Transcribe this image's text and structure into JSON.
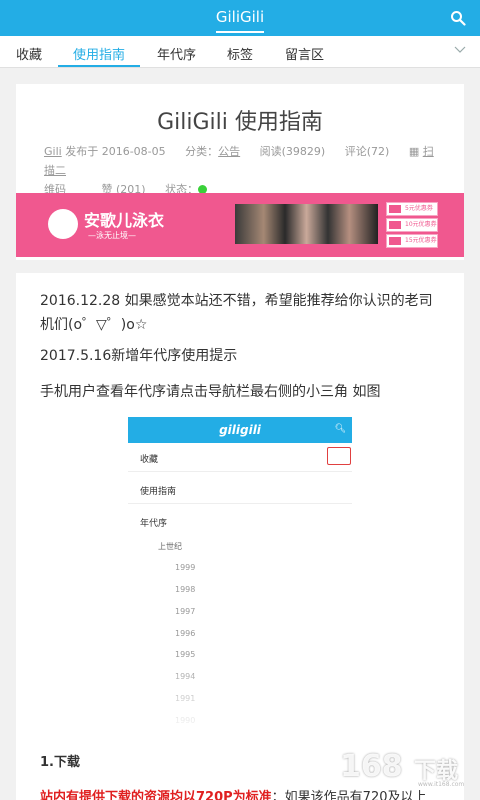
{
  "header": {
    "title": "GiliGili"
  },
  "nav": {
    "tabs": [
      {
        "label": "收藏"
      },
      {
        "label": "使用指南",
        "active": true
      },
      {
        "label": "年代序"
      },
      {
        "label": "标签"
      },
      {
        "label": "留言区"
      }
    ]
  },
  "post": {
    "title": "GiliGili 使用指南",
    "author": "Gili",
    "published": "发布于 2016-08-05",
    "category_label": "分类：",
    "category": "公告",
    "reads": "阅读(39829)",
    "comments": "评论(72)",
    "qr_label": "扫描二维码",
    "qr_label_line1": "扫描二",
    "qr_label_line2": "维码",
    "likes": "赞 (201)",
    "status_label": "状态："
  },
  "ad": {
    "brand": "安歌儿泳衣",
    "slogan": "—泳无止境—",
    "coupons": [
      "5元优惠券",
      "10元优惠券",
      "15元优惠券"
    ]
  },
  "content": {
    "p1": "2016.12.28  如果感觉本站还不错，希望能推荐给你认识的老司机们(o゜▽゜)o☆",
    "p2": "2017.5.16新增年代序使用提示",
    "p3": "手机用户查看年代序请点击导航栏最右侧的小三角  如图",
    "screenshot": {
      "brand": "giligili",
      "rows": [
        "收藏",
        "使用指南",
        "年代序"
      ],
      "sub": "上世纪",
      "years": [
        "1999",
        "1998",
        "1997",
        "1996",
        "1995",
        "1994",
        "1991",
        "1990"
      ]
    },
    "section_title": "1.下载",
    "last_red": "站内有提供下载的资源均以720P为标准",
    "last_rest": "：如果该作品有720及以上"
  },
  "watermark": {
    "text": "168",
    "suffix": "下载",
    "site": "www.it168.com"
  },
  "colors": {
    "primary": "#23ade5",
    "ad_pink": "#f0588f",
    "status_green": "#3ad13a",
    "emphasis_red": "#e02020"
  }
}
